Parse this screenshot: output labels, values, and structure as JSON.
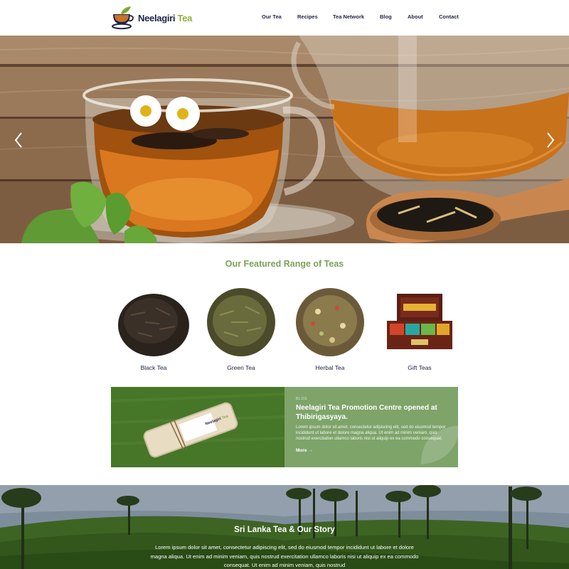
{
  "brand": {
    "name_part1": "Neelagiri",
    "name_part2": "Tea"
  },
  "nav": {
    "items": [
      {
        "label": "Our Tea"
      },
      {
        "label": "Recipes"
      },
      {
        "label": "Tea Network"
      },
      {
        "label": "Blog"
      },
      {
        "label": "About"
      },
      {
        "label": "Contact"
      }
    ]
  },
  "hero": {
    "prev_icon": "chevron-left-icon",
    "next_icon": "chevron-right-icon"
  },
  "featured": {
    "title": "Our Featured Range of Teas",
    "items": [
      {
        "label": "Black Tea"
      },
      {
        "label": "Green Tea"
      },
      {
        "label": "Herbal Tea"
      },
      {
        "label": "Gift Teas"
      }
    ]
  },
  "blog": {
    "tag": "BLOG",
    "title": "Neelagiri Tea Promotion Centre opened at Thibirigasyaya.",
    "body": "Lorem ipsum dolor sit amet, consectetur adipiscing elit, sed do eiusmod tempor incididunt ut labore et dolore magna aliqua. Ut enim ad minim veniam, quis nostrud exercitation ullamco laboris nisi ut aliquip ex ea commodo consequat.",
    "more": "More →",
    "pouch_label_1": "Neelagiri",
    "pouch_label_2": "Tea"
  },
  "story": {
    "title": "Sri Lanka Tea & Our Story",
    "body": "Lorem ipsum dolor sit amet, consectetur adipiscing elit, sed do eiusmod tempor incididunt ut labore et dolore magna aliqua. Ut enim ad minim veniam, quis nostrud exercitation ullamco laboris nisi ut aliquip ex ea commodo consequat. Ut enim ad minim veniam, quis nostrud"
  },
  "colors": {
    "navy": "#1f2347",
    "brand_green": "#8cb23a",
    "title_green": "#7aa25a",
    "blog_panel": "#7ea46a"
  }
}
